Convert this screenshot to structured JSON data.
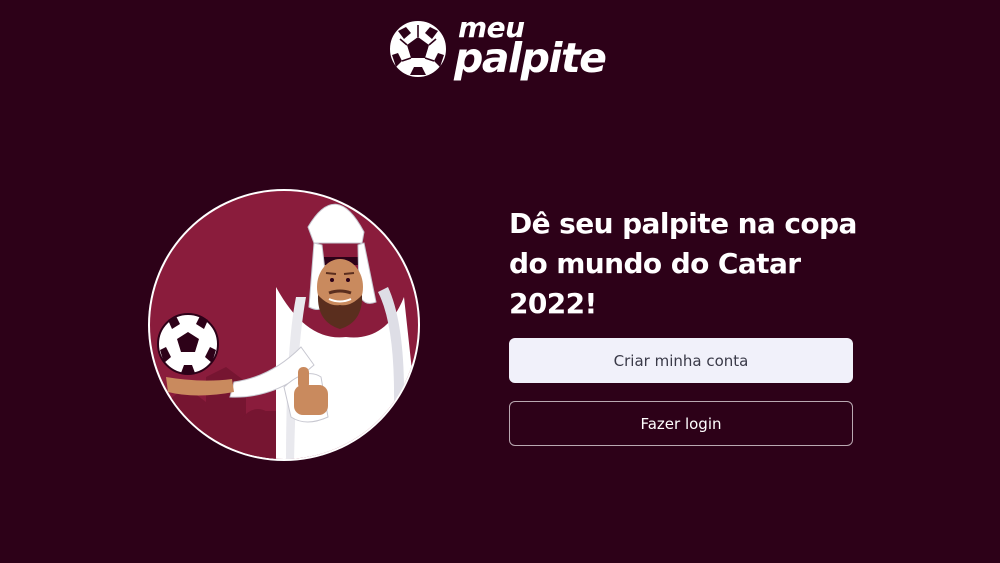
{
  "header": {
    "logo_line1": "meu",
    "logo_line2": "palpite"
  },
  "hero": {
    "heading": "Dê seu palpite na copa do mundo do Catar 2022!"
  },
  "actions": {
    "create_account_label": "Criar minha conta",
    "login_label": "Fazer login"
  },
  "colors": {
    "background": "#2d0118",
    "illustration_bg": "#8a1c3c",
    "primary_button_bg": "#f1f1fa",
    "primary_button_text": "#3a3a48",
    "text": "#ffffff"
  },
  "icons": {
    "logo": "soccer-ball-icon",
    "illustration": "qatari-man-with-ball-illustration"
  }
}
